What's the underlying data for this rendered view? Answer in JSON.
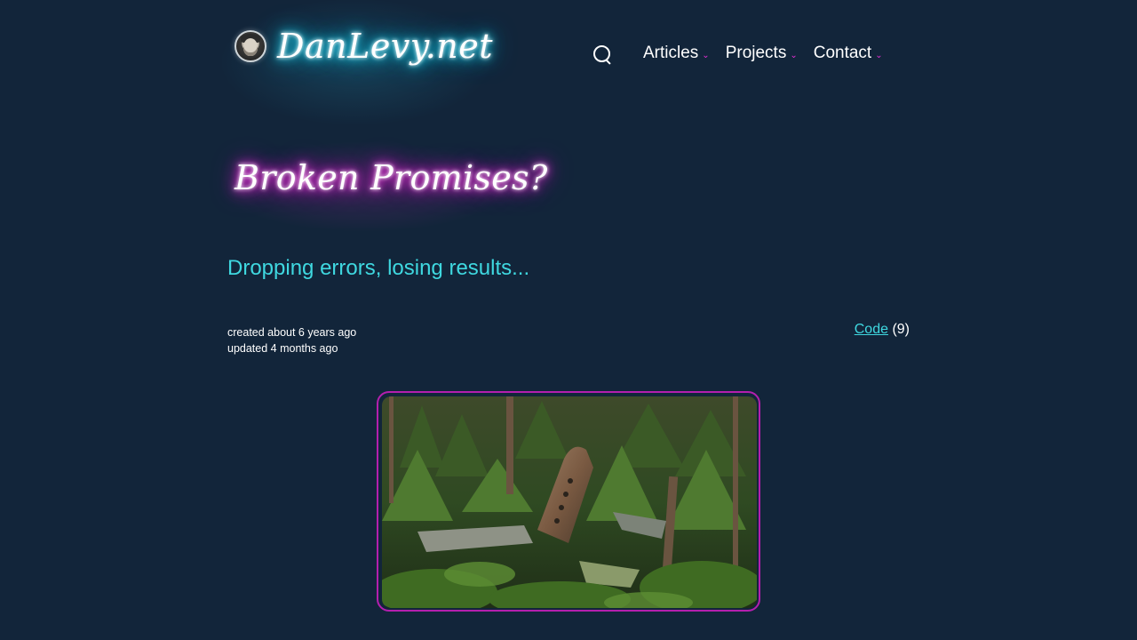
{
  "site": {
    "brand": "DanLevy.net",
    "avatar_alt": "avatar"
  },
  "nav": {
    "search_icon": "search-icon",
    "items": [
      {
        "label": "Articles",
        "caret": "⌄"
      },
      {
        "label": "Projects",
        "caret": "⌄"
      },
      {
        "label": "Contact",
        "caret": "⌄"
      }
    ]
  },
  "post": {
    "title": "Broken Promises?",
    "subtitle": "Dropping errors, losing results...",
    "created": "created about 6 years ago",
    "updated": "updated 4 months ago",
    "tag_label": "Code",
    "tag_count": "(9)"
  },
  "colors": {
    "background": "#12253a",
    "accent_cyan": "#3fd8e0",
    "accent_magenta": "#e02fd0",
    "image_border": "#b41fae"
  }
}
